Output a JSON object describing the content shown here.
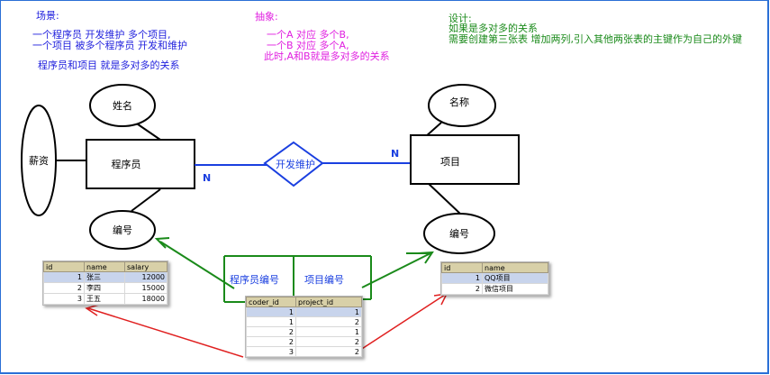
{
  "notes": {
    "scenario": {
      "title": "场景:",
      "lines": [
        "一个程序员 开发维护 多个项目,",
        "一个项目 被多个程序员 开发和维护"
      ],
      "summary": "程序员和项目 就是多对多的关系"
    },
    "abstract": {
      "title": "抽象:",
      "lines": [
        "一个A 对应 多个B,",
        "一个B 对应 多个A,",
        "此时,A和B就是多对多的关系"
      ]
    },
    "design": {
      "title": "设计:",
      "lines": [
        "如果是多对多的关系",
        "需要创建第三张表 增加两列,引入其他两张表的主键作为自己的外键"
      ]
    }
  },
  "diagram": {
    "programmer_entity": "程序员",
    "project_entity": "项目",
    "relationship": "开发维护",
    "attr_name": "姓名",
    "attr_salary": "薪资",
    "attr_programmer_id": "编号",
    "attr_project_name": "名称",
    "attr_project_id": "编号",
    "card_left": "N",
    "card_right": "N",
    "link_col1": "程序员编号",
    "link_col2": "项目编号"
  },
  "tables": {
    "coder": {
      "columns": [
        "id",
        "name",
        "salary"
      ],
      "rows": [
        [
          "1",
          "张三",
          "12000"
        ],
        [
          "2",
          "李四",
          "15000"
        ],
        [
          "3",
          "王五",
          "18000"
        ]
      ]
    },
    "project": {
      "columns": [
        "id",
        "name"
      ],
      "rows": [
        [
          "1",
          "QQ项目"
        ],
        [
          "2",
          "微信项目"
        ]
      ]
    },
    "coder_project": {
      "columns": [
        "coder_id",
        "project_id"
      ],
      "rows": [
        [
          "1",
          "1"
        ],
        [
          "1",
          "2"
        ],
        [
          "2",
          "1"
        ],
        [
          "2",
          "2"
        ],
        [
          "3",
          "2"
        ]
      ]
    }
  },
  "colors": {
    "blue_note": "#1f1fdd",
    "magenta_note": "#e020e0",
    "green": "#1a8a1a",
    "red": "#e02020",
    "relation_blue": "#1a3fe0"
  }
}
